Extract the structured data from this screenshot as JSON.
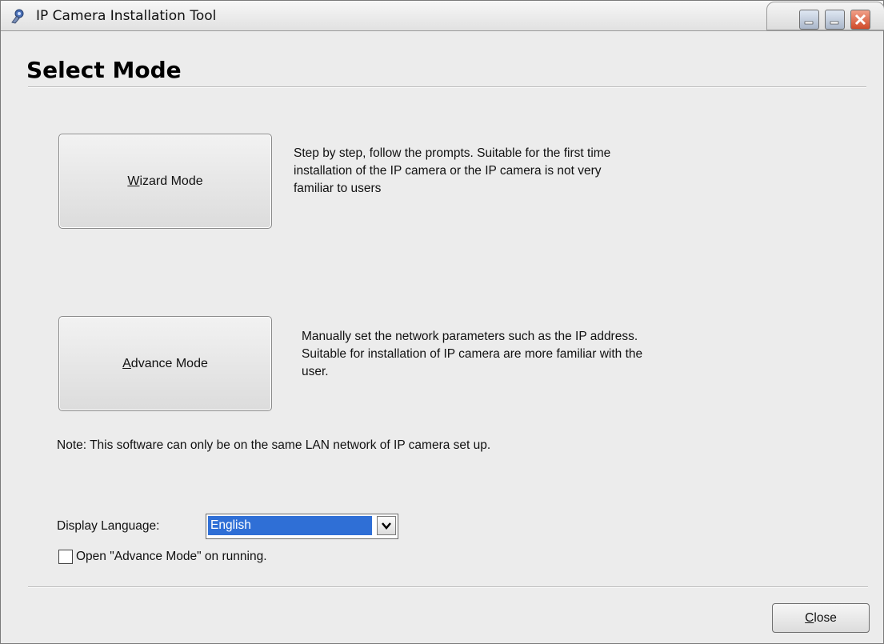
{
  "window": {
    "title": "IP Camera Installation Tool"
  },
  "heading": "Select Mode",
  "wizard": {
    "label_accel": "W",
    "label_rest": "izard Mode",
    "description": [
      "Step by step, follow the prompts. Suitable for the first time",
      "installation of the IP camera or the IP camera is not very",
      "familiar to users"
    ]
  },
  "advance": {
    "label_accel": "A",
    "label_rest": "dvance Mode",
    "description": [
      "Manually set the network parameters such as the IP address.",
      "Suitable for installation of IP camera are more familiar with the",
      "user."
    ]
  },
  "note": "Note: This software can only be on the same LAN network of IP camera set up.",
  "language": {
    "label": "Display Language:",
    "selected": "English"
  },
  "startup_option": {
    "label": "Open \"Advance Mode\" on running.",
    "checked": false
  },
  "close_button": {
    "label_accel": "C",
    "label_rest": "lose"
  },
  "colors": {
    "selection": "#2f6fd6",
    "close_button": "#cf4a2a"
  },
  "icons": [
    "app-icon",
    "minimize-icon",
    "close-icon",
    "chevron-down-icon"
  ]
}
